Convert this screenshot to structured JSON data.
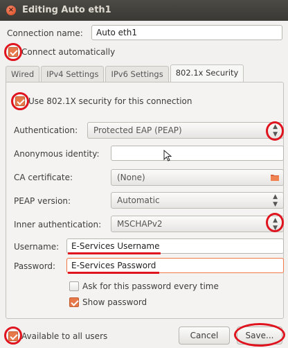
{
  "window": {
    "title": "Editing Auto eth1"
  },
  "connection": {
    "name_label": "Connection name:",
    "name_value": "Auto eth1",
    "connect_auto_label": "Connect automatically"
  },
  "tabs": [
    {
      "label": "Wired"
    },
    {
      "label": "IPv4 Settings"
    },
    {
      "label": "IPv6 Settings"
    },
    {
      "label": "802.1x Security"
    }
  ],
  "security": {
    "use_8021x_label": "Use 802.1X security for this connection",
    "authentication_label": "Authentication:",
    "authentication_value": "Protected EAP (PEAP)",
    "anon_identity_label": "Anonymous identity:",
    "anon_identity_value": "",
    "ca_cert_label": "CA certificate:",
    "ca_cert_value": "(None)",
    "peap_version_label": "PEAP version:",
    "peap_version_value": "Automatic",
    "inner_auth_label": "Inner authentication:",
    "inner_auth_value": "MSCHAPv2",
    "username_label": "Username:",
    "username_value": "E-Services Username",
    "password_label": "Password:",
    "password_value": "E-Services Password",
    "ask_password_label": "Ask for this password every time",
    "show_password_label": "Show password"
  },
  "footer": {
    "available_all_label": "Available to all users",
    "cancel_label": "Cancel",
    "save_label": "Save..."
  },
  "colors": {
    "accent": "#e7784a",
    "annotation_red": "#e0141e",
    "titlebar": "#3c3b37"
  }
}
